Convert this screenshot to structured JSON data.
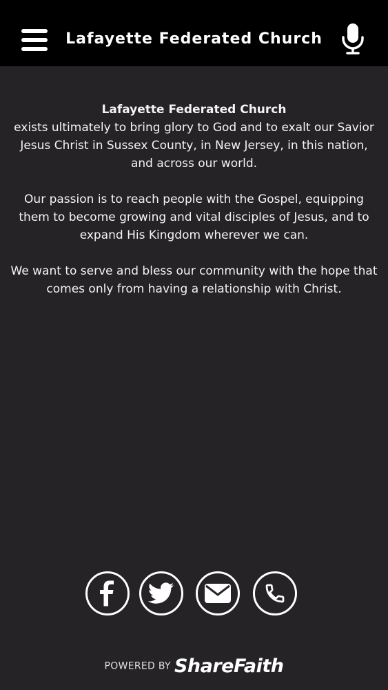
{
  "header": {
    "title": "Lafayette Federated Church",
    "menu_icon": "hamburger-menu-icon",
    "mic_icon": "microphone-icon"
  },
  "content": {
    "church_name": "Lafayette Federated Church",
    "paragraph_1": "exists ultimately to bring glory to God and to exalt our Savior Jesus Christ in Sussex County, in New Jersey, in this nation, and across our world.",
    "paragraph_2": "Our passion is to reach people with the Gospel, equipping them to become growing and vital disciples of Jesus, and to expand His Kingdom wherever we can.",
    "paragraph_3": "We want to serve and bless our community with the hope that comes only from having a relationship with Christ."
  },
  "social": {
    "items": [
      {
        "icon": "facebook-icon"
      },
      {
        "icon": "twitter-icon"
      },
      {
        "icon": "email-icon"
      },
      {
        "icon": "phone-icon"
      }
    ]
  },
  "footer": {
    "powered_by": "POWERED BY",
    "brand": "ShareFaith"
  },
  "colors": {
    "header_bg": "#000000",
    "page_bg": "#252326",
    "text": "#ffffff"
  }
}
